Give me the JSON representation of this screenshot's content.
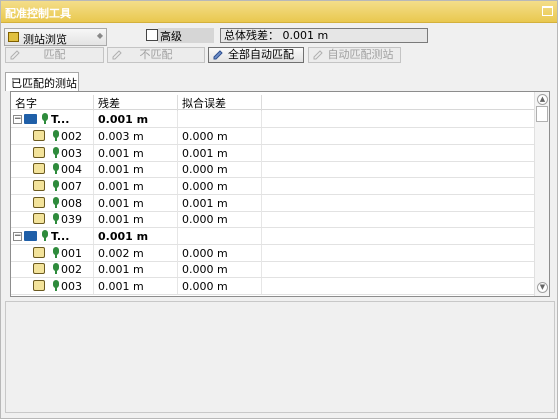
{
  "window": {
    "title": "配准控制工具"
  },
  "toolbar": {
    "browse_combo": "测站浏览",
    "advanced_label": "高级",
    "total_residual": "总体残差： 0.001 m",
    "match_btn": "匹配",
    "unmatch_btn": "不匹配",
    "auto_all_btn": "全部自动匹配",
    "auto_station_btn": "自动匹配测站"
  },
  "tabs": {
    "matched": "已匹配的测站"
  },
  "grid": {
    "headers": {
      "name": "名字",
      "residual": "残差",
      "fit_error": "拟合误差"
    },
    "group1": {
      "label": "T...",
      "residual": "0.001 m",
      "rows": [
        {
          "name": "002",
          "residual": "0.003 m",
          "fit": "0.000 m"
        },
        {
          "name": "003",
          "residual": "0.001 m",
          "fit": "0.001 m"
        },
        {
          "name": "004",
          "residual": "0.001 m",
          "fit": "0.000 m"
        },
        {
          "name": "007",
          "residual": "0.001 m",
          "fit": "0.000 m"
        },
        {
          "name": "008",
          "residual": "0.001 m",
          "fit": "0.001 m"
        },
        {
          "name": "039",
          "residual": "0.001 m",
          "fit": "0.000 m"
        }
      ]
    },
    "group2": {
      "label": "T...",
      "residual": "0.001 m",
      "rows": [
        {
          "name": "001",
          "residual": "0.002 m",
          "fit": "0.000 m"
        },
        {
          "name": "002",
          "residual": "0.001 m",
          "fit": "0.000 m"
        },
        {
          "name": "003",
          "residual": "0.001 m",
          "fit": "0.000 m"
        }
      ]
    }
  }
}
